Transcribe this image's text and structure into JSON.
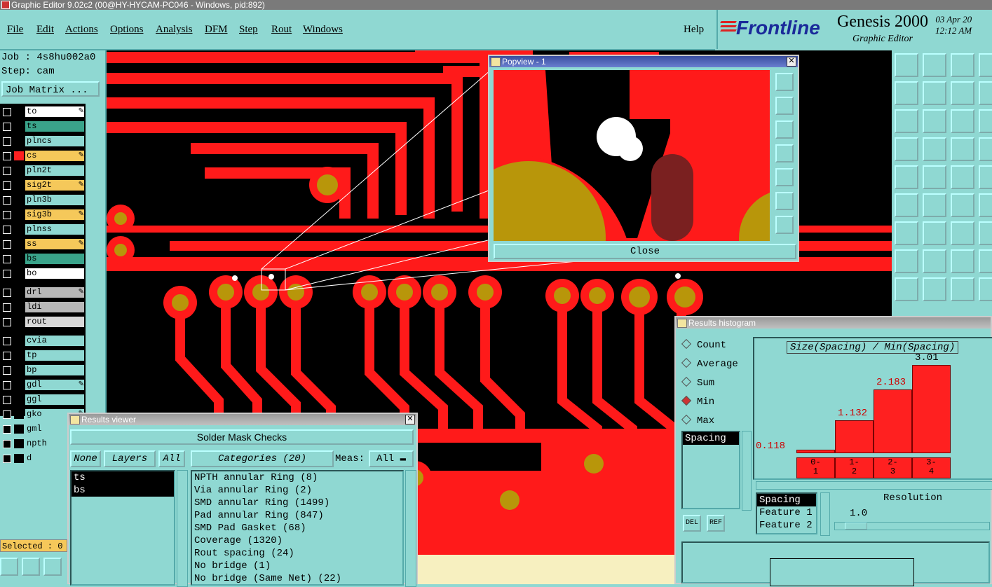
{
  "window_title": "Graphic Editor 9.02c2 (00@HY-HYCAM-PC046 - Windows, pid:892)",
  "menu": [
    "File",
    "Edit",
    "Actions",
    "Options",
    "Analysis",
    "DFM",
    "Step",
    "Rout",
    "Windows"
  ],
  "help": "Help",
  "brand": {
    "logo": "Frontline",
    "product": "Genesis 2000",
    "subtitle": "Graphic Editor",
    "date": "03 Apr 20",
    "time": "12:12 AM"
  },
  "job": {
    "job_line": "Job : 4s8hu002a0",
    "step_line": "Step: cam",
    "matrix_button": "Job Matrix ..."
  },
  "layers": [
    {
      "name": "to",
      "color": "#ffffff",
      "swatch": "#000000",
      "edit": true
    },
    {
      "name": "ts",
      "color": "#3aa38a",
      "swatch": "#000000",
      "edit": false
    },
    {
      "name": "plncs",
      "color": "#8fd8d2",
      "swatch": "#000000",
      "edit": false
    },
    {
      "name": "cs",
      "color": "#f5c85a",
      "swatch": "#ff2020",
      "edit": true
    },
    {
      "name": "pln2t",
      "color": "#8fd8d2",
      "swatch": "#000000",
      "edit": false
    },
    {
      "name": "sig2t",
      "color": "#f5c85a",
      "swatch": "#000000",
      "edit": true
    },
    {
      "name": "pln3b",
      "color": "#8fd8d2",
      "swatch": "#000000",
      "edit": false
    },
    {
      "name": "sig3b",
      "color": "#f5c85a",
      "swatch": "#000000",
      "edit": true
    },
    {
      "name": "plnss",
      "color": "#8fd8d2",
      "swatch": "#000000",
      "edit": false
    },
    {
      "name": "ss",
      "color": "#f5c85a",
      "swatch": "#000000",
      "edit": true
    },
    {
      "name": "bs",
      "color": "#3aa38a",
      "swatch": "#000000",
      "edit": false
    },
    {
      "name": "bo",
      "color": "#ffffff",
      "swatch": "#000000",
      "edit": false
    },
    {
      "name": "drl",
      "color": "#b8b8b8",
      "swatch": "#000000",
      "edit": true
    },
    {
      "name": "ldi",
      "color": "#b8b8b8",
      "swatch": "#000000",
      "edit": false
    },
    {
      "name": "rout",
      "color": "#d8d8d8",
      "swatch": "#000000",
      "edit": false
    },
    {
      "name": "cvia",
      "color": "#8fd8d2",
      "swatch": "#000000",
      "edit": false
    },
    {
      "name": "tp",
      "color": "#8fd8d2",
      "swatch": "#000000",
      "edit": false
    },
    {
      "name": "bp",
      "color": "#8fd8d2",
      "swatch": "#000000",
      "edit": false
    },
    {
      "name": "gdl",
      "color": "#8fd8d2",
      "swatch": "#000000",
      "edit": true
    },
    {
      "name": "ggl",
      "color": "#8fd8d2",
      "swatch": "#000000",
      "edit": false
    },
    {
      "name": "gko",
      "color": "#8fd8d2",
      "swatch": "#000000",
      "edit": true
    },
    {
      "name": "gml",
      "color": "#8fd8d2",
      "swatch": "#000000",
      "edit": true
    },
    {
      "name": "npth",
      "color": "#8fd8d2",
      "swatch": "#000000",
      "edit": false
    },
    {
      "name": "d",
      "color": "#8fd8d2",
      "swatch": "#000000",
      "edit": false
    }
  ],
  "selected": "Selected : 0",
  "popview": {
    "title": "Popview - 1",
    "close_label": "Close"
  },
  "results_viewer": {
    "title": "Results viewer",
    "header": "Solder Mask Checks",
    "none": "None",
    "layers": "Layers",
    "all": "All",
    "categories": "Categories (20)",
    "meas_label": "Meas:",
    "meas_value": "All",
    "layer_items": [
      "ts",
      "bs"
    ],
    "category_items": [
      "NPTH annular Ring (8)",
      "Via annular Ring (2)",
      "SMD annular Ring (1499)",
      "Pad annular Ring (847)",
      "SMD Pad Gasket (68)",
      "Coverage (1320)",
      "Rout spacing (24)",
      "No bridge (1)",
      "No bridge (Same Net) (22)"
    ]
  },
  "histogram": {
    "title": "Results histogram",
    "radios": [
      {
        "label": "Count",
        "on": false
      },
      {
        "label": "Average",
        "on": false
      },
      {
        "label": "Sum",
        "on": false
      },
      {
        "label": "Min",
        "on": true
      },
      {
        "label": "Max",
        "on": false
      }
    ],
    "metric_list": [
      "Spacing"
    ],
    "chart_title": "Size(Spacing) / Min(Spacing)",
    "bins": [
      {
        "label_top": "0-",
        "label_bot": "1",
        "value": "0.118",
        "v": 0.118
      },
      {
        "label_top": "1-",
        "label_bot": "2",
        "value": "1.132",
        "v": 1.132
      },
      {
        "label_top": "2-",
        "label_bot": "3",
        "value": "2.183",
        "v": 2.183
      },
      {
        "label_top": "3-",
        "label_bot": "4",
        "value": "3.01",
        "v": 3.01
      }
    ],
    "fields": [
      "Spacing",
      "Feature 1",
      "Feature 2"
    ],
    "resolution_label": "Resolution",
    "resolution_value": "1.0",
    "del_label": "DEL",
    "ref_label": "REF"
  }
}
